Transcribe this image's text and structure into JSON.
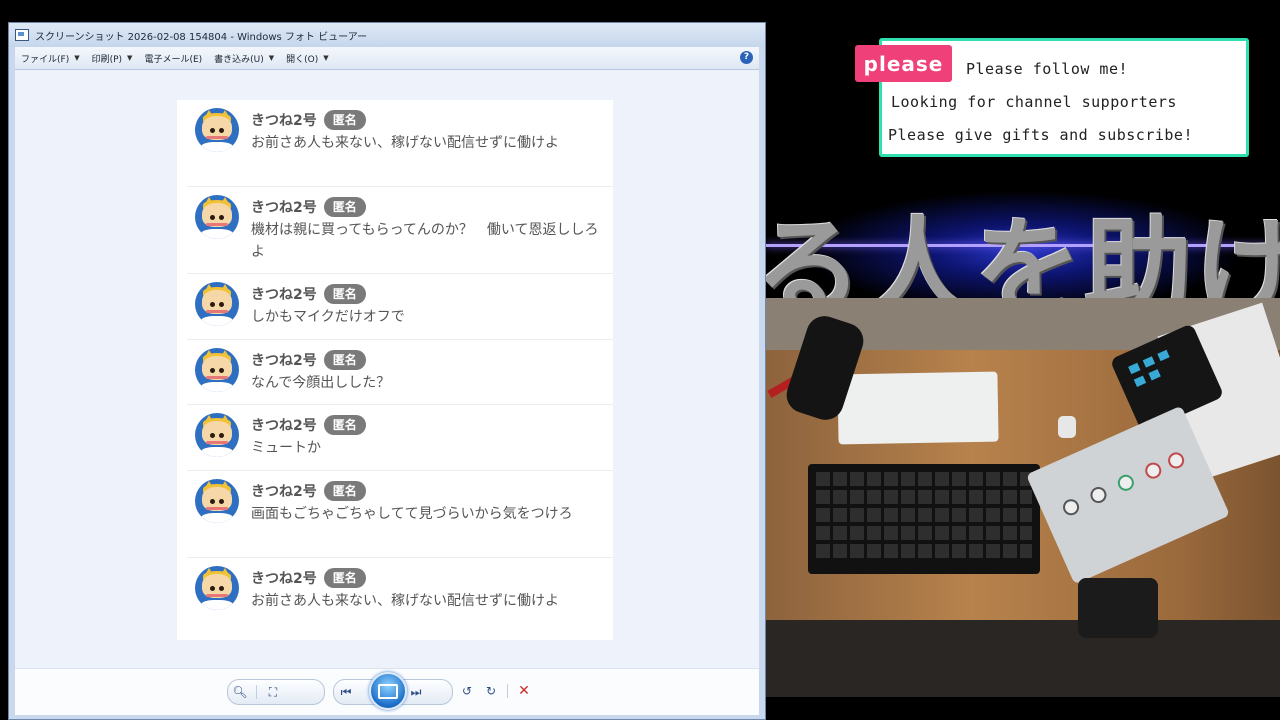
{
  "window": {
    "title": "スクリーンショット 2026-02-08 154804 - Windows フォト ビューアー",
    "menu": [
      {
        "label": "ファイル(F)",
        "has_caret": true
      },
      {
        "label": "印刷(P)",
        "has_caret": true
      },
      {
        "label": "電子メール(E)",
        "has_caret": false
      },
      {
        "label": "書き込み(U)",
        "has_caret": true
      },
      {
        "label": "開く(O)",
        "has_caret": true
      }
    ],
    "help_label": "?"
  },
  "comments": [
    {
      "name": "きつね2号",
      "badge": "匿名",
      "text": "お前さあ人も来ない、稼げない配信せずに働けよ"
    },
    {
      "name": "きつね2号",
      "badge": "匿名",
      "text": "機材は親に買ってもらってんのか？　働いて恩返ししろよ"
    },
    {
      "name": "きつね2号",
      "badge": "匿名",
      "text": "しかもマイクだけオフで"
    },
    {
      "name": "きつね2号",
      "badge": "匿名",
      "text": "なんで今顔出しした？"
    },
    {
      "name": "きつね2号",
      "badge": "匿名",
      "text": "ミュートか"
    },
    {
      "name": "きつね2号",
      "badge": "匿名",
      "text": "画面もごちゃごちゃしてて見づらいから気をつけろ"
    },
    {
      "name": "きつね2号",
      "badge": "匿名",
      "text": "お前さあ人も来ない、稼げない配信せずに働けよ"
    }
  ],
  "overlay": {
    "tag": "please",
    "lines": [
      "Please follow me!",
      "Looking for channel supporters",
      "Please give gifts and subscribe!"
    ],
    "banner_text": "る人を助ける",
    "accent_color": "#2ee0b0",
    "tag_color": "#f0407a"
  }
}
